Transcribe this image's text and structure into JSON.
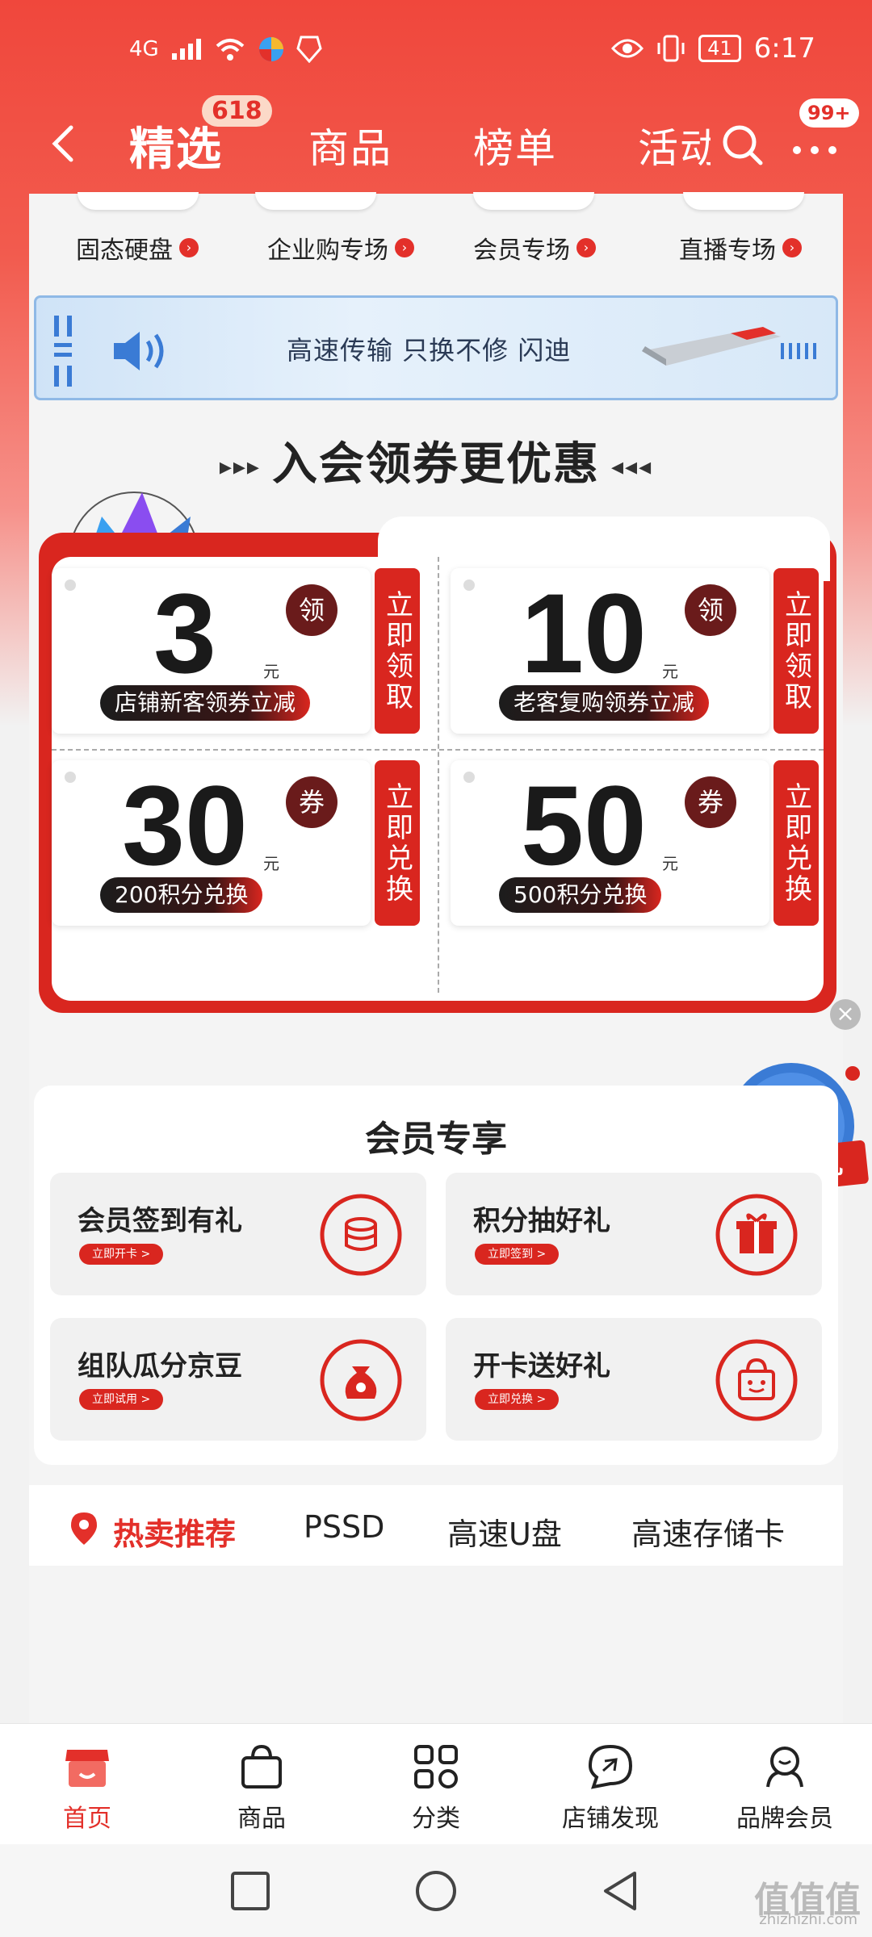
{
  "status_bar": {
    "signal": "4G",
    "battery": "41",
    "time": "6:17"
  },
  "top_nav": {
    "tabs": [
      "精选",
      "商品",
      "榜单",
      "活动"
    ],
    "active_badge": "618",
    "more_badge": "99+"
  },
  "quick_links": [
    "固态硬盘",
    "企业购专场",
    "会员专场",
    "直播专场"
  ],
  "banner": {
    "text": "高速传输 只换不修   闪迪"
  },
  "coupons": {
    "title": "入会领券更优惠",
    "items": [
      {
        "value": "3",
        "unit": "元",
        "desc": "店铺新客领券立减",
        "tag": "领",
        "action": "立即领取"
      },
      {
        "value": "10",
        "unit": "元",
        "desc": "老客复购领券立减",
        "tag": "领",
        "action": "立即领取"
      },
      {
        "value": "30",
        "unit": "元",
        "desc": "200积分兑换",
        "tag": "券",
        "action": "立即兑换"
      },
      {
        "value": "50",
        "unit": "元",
        "desc": "500积分兑换",
        "tag": "券",
        "action": "立即兑换"
      }
    ]
  },
  "floating": {
    "cart_label": "加购有礼"
  },
  "member": {
    "title": "会员专享",
    "items": [
      {
        "label": "会员签到有礼",
        "button": "立即开卡 >",
        "icon": "coins-icon"
      },
      {
        "label": "积分抽好礼",
        "button": "立即签到 >",
        "icon": "gift-icon"
      },
      {
        "label": "组队瓜分京豆",
        "button": "立即试用 >",
        "icon": "money-bag-icon"
      },
      {
        "label": "开卡送好礼",
        "button": "立即兑换 >",
        "icon": "shopping-bag-icon"
      }
    ]
  },
  "hot_tabs": [
    "热卖推荐",
    "PSSD",
    "高速U盘",
    "高速存储卡"
  ],
  "bottom_nav": [
    {
      "label": "首页",
      "icon": "shop-home-icon"
    },
    {
      "label": "商品",
      "icon": "bag-icon"
    },
    {
      "label": "分类",
      "icon": "grid-icon"
    },
    {
      "label": "店铺发现",
      "icon": "chat-discover-icon"
    },
    {
      "label": "品牌会员",
      "icon": "member-icon"
    }
  ],
  "watermark": {
    "main": "值值值",
    "sub": "zhizhizhi.com"
  },
  "colors": {
    "accent": "#e3302a",
    "coupon_red": "#d9261f"
  }
}
